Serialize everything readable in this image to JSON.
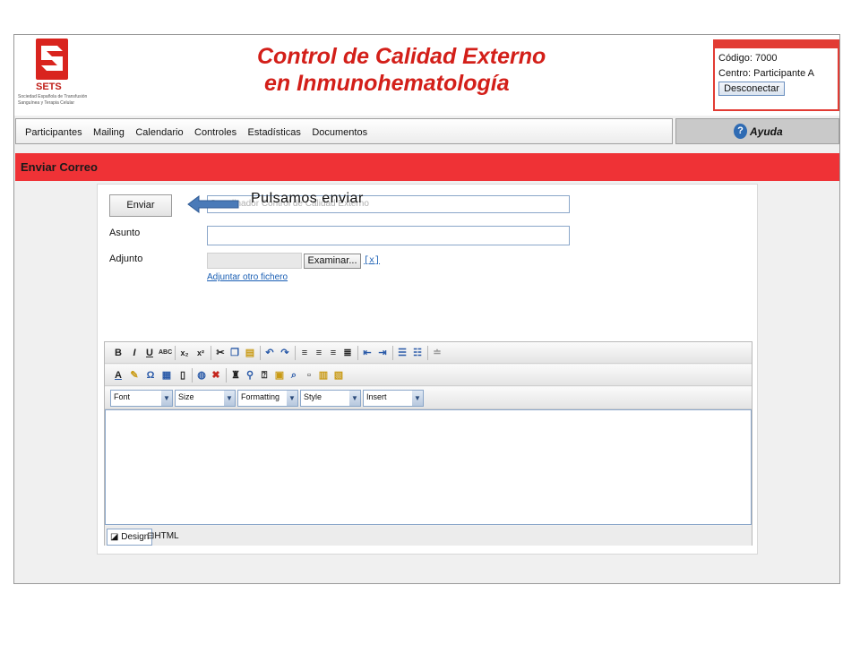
{
  "header": {
    "logo_text": "SETS",
    "logo_sub": "Sociedad Española de Transfusión Sanguínea y Terapia Celular",
    "title_line1": "Control de Calidad Externo",
    "title_line2": "en Inmunohematología",
    "codigo_label": "Código:",
    "codigo_value": "7000",
    "centro_label": "Centro:",
    "centro_value": "Participante A",
    "disconnect_label": "Desconectar",
    "accent_color": "#ef3236"
  },
  "nav": {
    "items": [
      "Participantes",
      "Mailing",
      "Calendario",
      "Controles",
      "Estadísticas",
      "Documentos"
    ],
    "help_label": "Ayuda",
    "help_icon": "question-icon"
  },
  "section": {
    "title": "Enviar Correo"
  },
  "form": {
    "send_label": "Enviar",
    "from_value": "Coordinador Control de Calidad Externo",
    "subject_label": "Asunto",
    "subject_value": "",
    "attach_label": "Adjunto",
    "browse_label": "Examinar...",
    "remove_link": "[x]",
    "add_attachment_link": "Adjuntar otro fichero"
  },
  "annotation": {
    "text": "Pulsamos enviar"
  },
  "editor": {
    "dropdowns": [
      "Font",
      "Size",
      "Formatting",
      "Style",
      "Insert"
    ],
    "mode_design": "Design",
    "mode_html": "HTML"
  }
}
